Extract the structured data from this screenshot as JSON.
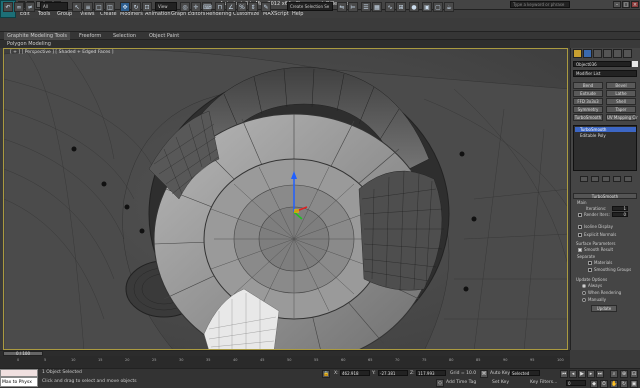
{
  "titlebar": {
    "title": "Autodesk 3ds Max 2012 x64 · Steampunk Rifle.max",
    "search_placeholder": "Type a keyword or phrase"
  },
  "menu": [
    "Edit",
    "Tools",
    "Group",
    "Views",
    "Create",
    "Modifiers",
    "Animation",
    "Graph Editors",
    "Rendering",
    "Customize",
    "MAXScript",
    "Help"
  ],
  "toolbar": {
    "selection_filter": "All",
    "view_dropdown": "View",
    "named_selection": "Create Selection Se"
  },
  "ribbon": {
    "tabs": [
      "Graphite Modeling Tools",
      "Freeform",
      "Selection",
      "Object Paint"
    ],
    "sub_label": "Polygon Modeling"
  },
  "viewport": {
    "label": "[ + ] [ Perspective ] [ Shaded + Edged Faces ]"
  },
  "command_panel": {
    "object_name": "Object036",
    "modifier_list": "Modifier List",
    "modifier_buttons": [
      "Bend",
      "Bevel",
      "Extrude",
      "Lathe",
      "FFD 3x3x3",
      "Shell",
      "Symmetry",
      "Taper",
      "TurboSmooth",
      "UV Mapping Clr"
    ],
    "stack": [
      "TurboSmooth",
      "Editable Poly"
    ],
    "rollout_title": "TurboSmooth",
    "main_label": "Main",
    "iterations_label": "Iterations:",
    "iterations_value": "1",
    "render_iters_label": "Render Iters:",
    "render_iters_value": "0",
    "isoline_label": "Isoline Display",
    "explicit_normals_label": "Explicit Normals",
    "surface_params_label": "Surface Parameters",
    "smooth_result_label": "Smooth Result",
    "separate_label": "Separate",
    "materials_label": "Materials",
    "smoothing_groups_label": "Smoothing Groups",
    "update_options_label": "Update Options",
    "always_label": "Always",
    "when_rendering_label": "When Rendering",
    "manually_label": "Manually",
    "update_button": "Update"
  },
  "timeline": {
    "slider": "0 / 100",
    "ticks": [
      "0",
      "5",
      "10",
      "15",
      "20",
      "25",
      "30",
      "35",
      "40",
      "45",
      "50",
      "55",
      "60",
      "65",
      "70",
      "75",
      "80",
      "85",
      "90",
      "95",
      "100"
    ]
  },
  "status": {
    "maxscript": "Max to Physx",
    "objects_selected": "1 Object Selected",
    "prompt": "Click and drag to select and move objects",
    "x_label": "X:",
    "x_value": "462.918",
    "y_label": "Y:",
    "y_value": "-27.381",
    "z_label": "Z:",
    "z_value": "117.993",
    "grid": "Grid = 10.0",
    "add_time_tag": "Add Time Tag",
    "auto_key": "Auto Key",
    "auto_key_mode": "Selected",
    "set_key": "Set Key",
    "key_filters": "Key Filters...",
    "frame": "0"
  }
}
